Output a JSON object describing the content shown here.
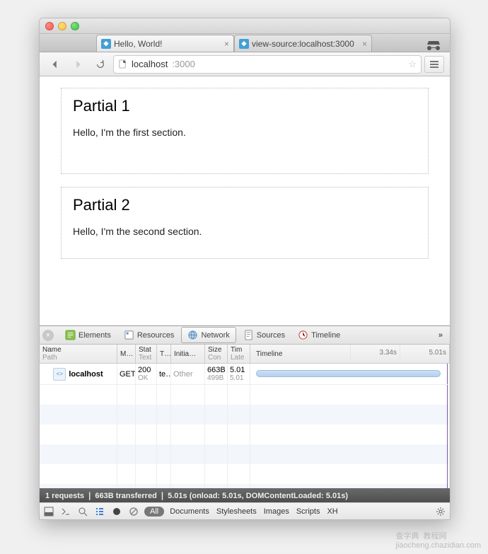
{
  "tabs": [
    {
      "title": "Hello, World!"
    },
    {
      "title": "view-source:localhost:3000"
    }
  ],
  "omnibox": {
    "host": "localhost",
    "path": ":3000"
  },
  "page": {
    "sections": [
      {
        "heading": "Partial 1",
        "body": "Hello, I'm the first section."
      },
      {
        "heading": "Partial 2",
        "body": "Hello, I'm the second section."
      }
    ]
  },
  "devtools": {
    "panels": [
      "Elements",
      "Resources",
      "Network",
      "Sources",
      "Timeline"
    ],
    "more": "»",
    "columns": {
      "name": "Name",
      "name_sub": "Path",
      "method": "M…",
      "status": "Stat",
      "status_sub": "Text",
      "type": "T…",
      "initiator": "Initia…",
      "size": "Size",
      "size_sub": "Con",
      "time": "Tim",
      "time_sub": "Late",
      "timeline": "Timeline"
    },
    "ticks": [
      "3.34s",
      "5.01s"
    ],
    "rows": [
      {
        "name": "localhost",
        "method": "GET",
        "status": "200",
        "status_text": "OK",
        "type": "te…",
        "initiator": "Other",
        "size": "663B",
        "size_content": "499B",
        "time": "5.01",
        "latency": "5.01"
      }
    ],
    "summary": "1 requests  ❘  663B transferred  ❘  5.01s (onload: 5.01s, DOMContentLoaded: 5.01s)",
    "filters": {
      "all": "All",
      "items": [
        "Documents",
        "Stylesheets",
        "Images",
        "Scripts",
        "XH"
      ]
    }
  },
  "watermark": {
    "cn": "查字典",
    "en": "教程网",
    "url": "jiaocheng.chazidian.com"
  }
}
